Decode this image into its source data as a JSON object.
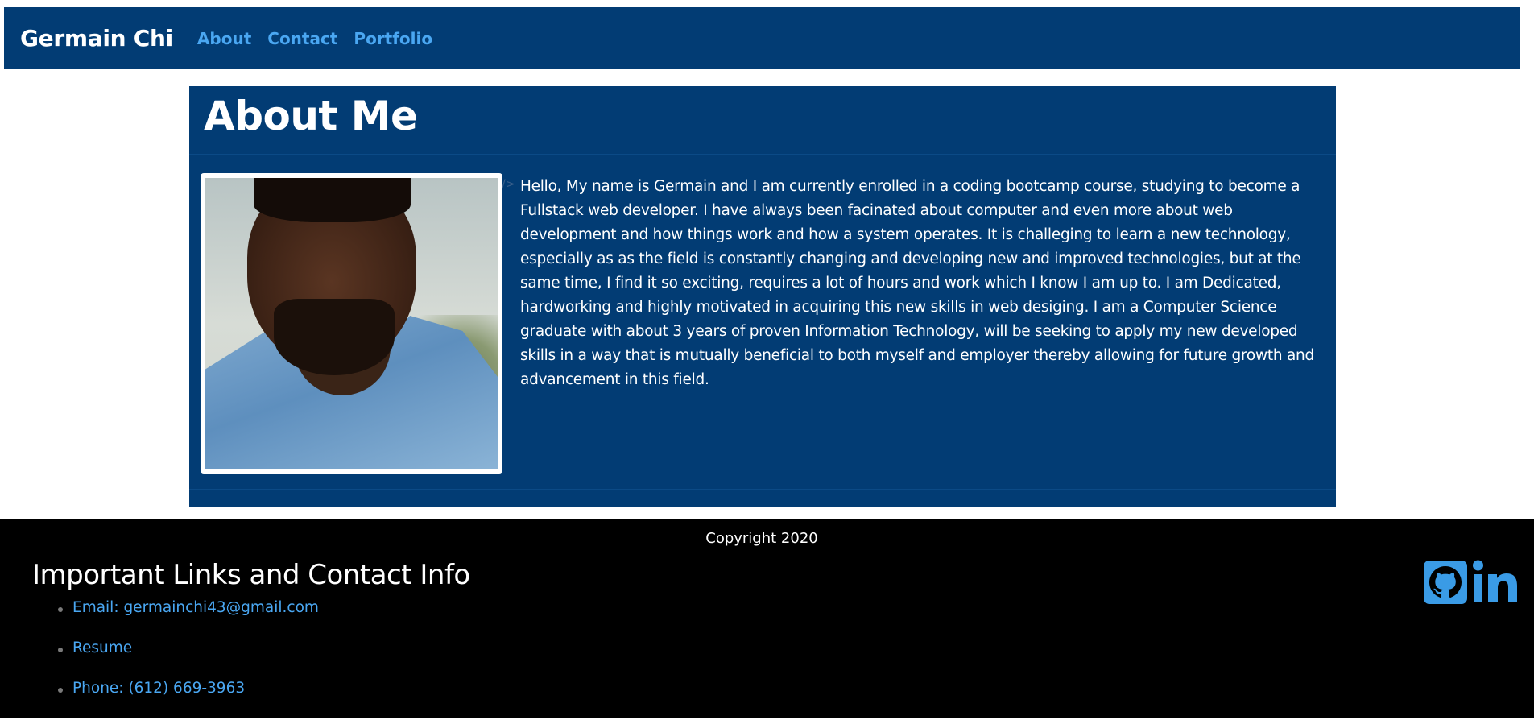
{
  "navbar": {
    "brand": "Germain Chi",
    "links": [
      "About",
      "Contact",
      "Portfolio"
    ]
  },
  "about": {
    "title": "About Me",
    "caret": "/>",
    "bio": "Hello, My name is Germain and I am currently enrolled in a coding bootcamp course, studying to become a Fullstack web developer. I have always been facinated about computer and even more about web development and how things work and how a system operates. It is challeging to learn a new technology, especially as as the field is constantly changing and developing new and improved technologies, but at the same time, I find it so exciting, requires a lot of hours and work which I know I am up to. I am Dedicated, hardworking and highly motivated in acquiring this new skills in web desiging. I am a Computer Science graduate with about 3 years of proven Information Technology, will be seeking to apply my new developed skills in a way that is mutually beneficial to both myself and employer thereby allowing for future growth and advancement in this field."
  },
  "footer": {
    "copyright": "Copyright 2020",
    "title": "Important Links and Contact Info",
    "contacts": [
      "Email: germainchi43@gmail.com",
      "Resume",
      "Phone: (612) 669-3963"
    ],
    "social_icons": [
      "github-icon",
      "linkedin-icon"
    ]
  },
  "colors": {
    "navbar_bg": "#023c74",
    "link": "#4aa7f2",
    "footer_bg": "#000000",
    "icon_blue": "#3a9be6"
  }
}
